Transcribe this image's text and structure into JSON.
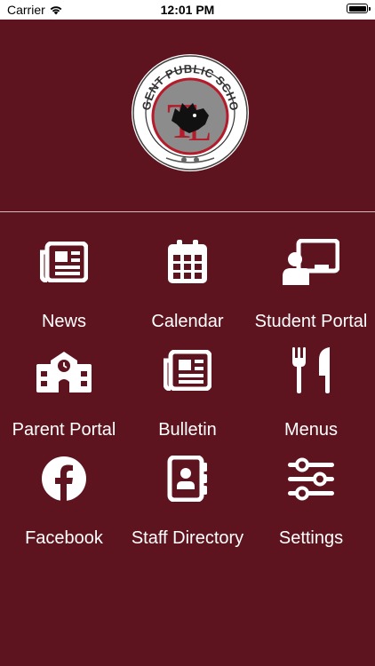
{
  "status_bar": {
    "carrier": "Carrier",
    "time": "12:01 PM"
  },
  "logo": {
    "text": "SARGENT PUBLIC SCHOOLS",
    "monogram": "TL"
  },
  "colors": {
    "background": "#5e141f",
    "logo_red": "#b41c2b",
    "tile_text": "#ffffff"
  },
  "menu": {
    "items": [
      {
        "label": "News",
        "icon": "newspaper-icon"
      },
      {
        "label": "Calendar",
        "icon": "calendar-icon"
      },
      {
        "label": "Student Portal",
        "icon": "student-portal-icon"
      },
      {
        "label": "Parent Portal",
        "icon": "school-building-icon"
      },
      {
        "label": "Bulletin",
        "icon": "newspaper-icon"
      },
      {
        "label": "Menus",
        "icon": "fork-knife-icon"
      },
      {
        "label": "Facebook",
        "icon": "facebook-icon"
      },
      {
        "label": "Staff Directory",
        "icon": "contact-book-icon"
      },
      {
        "label": "Settings",
        "icon": "sliders-icon"
      }
    ]
  }
}
